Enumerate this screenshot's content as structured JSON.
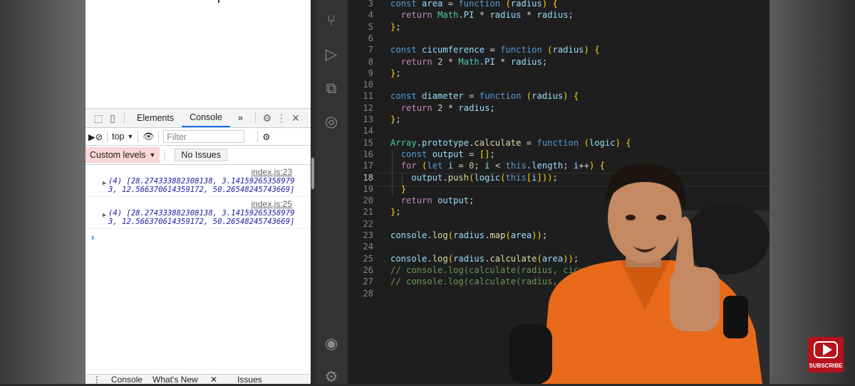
{
  "devtools": {
    "tabs": [
      "Elements",
      "Console"
    ],
    "more_tabs": "»",
    "context": "top",
    "filter_placeholder": "Filter",
    "custom_levels": "Custom levels",
    "no_issues": "No Issues",
    "logs": [
      {
        "source": "index.js:23",
        "line1": "(4) [28.274333882308138, 3.14159265358979",
        "line2": "3, 12.566370614359172, 50.26548245743669]"
      },
      {
        "source": "index.js:25",
        "line1": "(4) [28.274333882308138, 3.14159265358979",
        "line2": "3, 12.566370614359172, 50.26548245743669]"
      }
    ],
    "prompt": "›",
    "drawer_tabs": [
      "Console",
      "What's New",
      "Issues"
    ]
  },
  "editor": {
    "current_line": "18",
    "lines": [
      {
        "n": "3",
        "code": "const area = function (radius) {"
      },
      {
        "n": "4",
        "code": "  return Math.PI * radius * radius;"
      },
      {
        "n": "5",
        "code": "};"
      },
      {
        "n": "6",
        "code": ""
      },
      {
        "n": "7",
        "code": "const cicumference = function (radius) {"
      },
      {
        "n": "8",
        "code": "  return 2 * Math.PI * radius;"
      },
      {
        "n": "9",
        "code": "};"
      },
      {
        "n": "10",
        "code": ""
      },
      {
        "n": "11",
        "code": "const diameter = function (radius) {"
      },
      {
        "n": "12",
        "code": "  return 2 * radius;"
      },
      {
        "n": "13",
        "code": "};"
      },
      {
        "n": "14",
        "code": ""
      },
      {
        "n": "15",
        "code": "Array.prototype.calculate = function (logic) {"
      },
      {
        "n": "16",
        "code": "  const output = [];"
      },
      {
        "n": "17",
        "code": "  for (let i = 0; i < this.length; i++) {"
      },
      {
        "n": "18",
        "code": "    output.push(logic(this[i]));"
      },
      {
        "n": "19",
        "code": "  }"
      },
      {
        "n": "20",
        "code": "  return output;"
      },
      {
        "n": "21",
        "code": "};"
      },
      {
        "n": "22",
        "code": ""
      },
      {
        "n": "23",
        "code": "console.log(radius.map(area));"
      },
      {
        "n": "24",
        "code": ""
      },
      {
        "n": "25",
        "code": "console.log(radius.calculate(area));"
      },
      {
        "n": "26",
        "code": "// console.log(calculate(radius, cicumference));"
      },
      {
        "n": "27",
        "code": "// console.log(calculate(radius, diameter));"
      },
      {
        "n": "28",
        "code": ""
      }
    ]
  },
  "youtube": {
    "label": "SUBSCRIBE"
  },
  "colors": {
    "keyword": "#569cd6",
    "control": "#c586c0",
    "variable": "#9cdcfe",
    "function": "#dcdcaa",
    "type": "#4ec9b0",
    "number": "#b5cea8",
    "comment": "#6a9955",
    "bracket": "#ffd700"
  }
}
